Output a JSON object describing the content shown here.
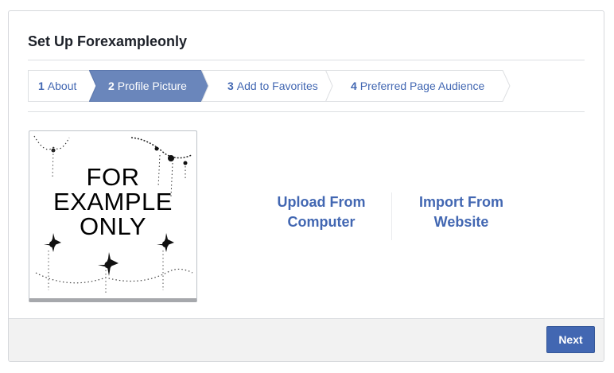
{
  "dialog": {
    "title": "Set Up Forexampleonly"
  },
  "steps": [
    {
      "num": "1",
      "label": "About",
      "active": false
    },
    {
      "num": "2",
      "label": "Profile Picture",
      "active": true
    },
    {
      "num": "3",
      "label": "Add to Favorites",
      "active": false
    },
    {
      "num": "4",
      "label": "Preferred Page Audience",
      "active": false
    }
  ],
  "profile_photo": {
    "lines": [
      "FOR",
      "EXAMPLE",
      "ONLY"
    ]
  },
  "actions": {
    "upload": {
      "line1": "Upload From",
      "line2": "Computer"
    },
    "import": {
      "line1": "Import From",
      "line2": "Website"
    }
  },
  "footer": {
    "next_label": "Next"
  },
  "colors": {
    "accent": "#4267b2",
    "active_step": "#6a86bb",
    "footer_bg": "#f2f2f2"
  }
}
